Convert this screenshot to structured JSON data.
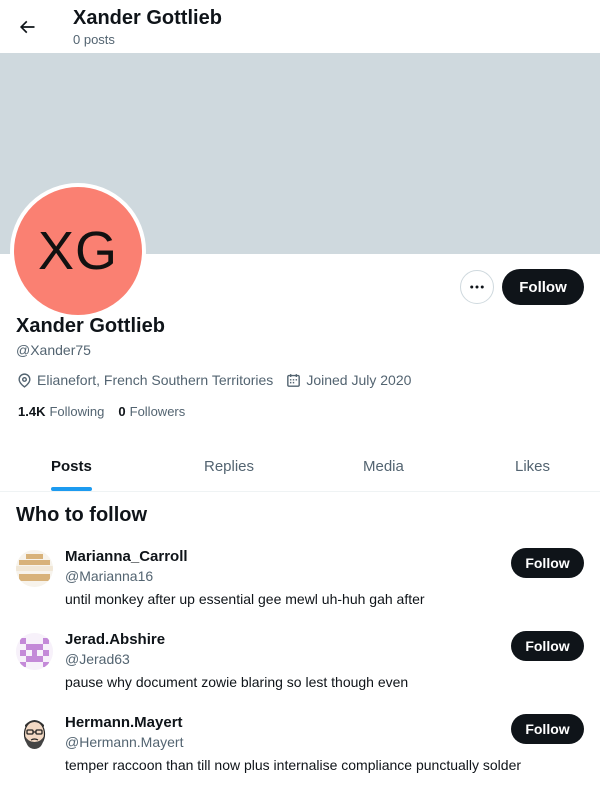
{
  "header": {
    "name": "Xander Gottlieb",
    "posts_count": "0 posts",
    "back_icon": "arrow-left-icon"
  },
  "banner": {
    "color": "#cfd9de"
  },
  "profile": {
    "avatar_initials": "XG",
    "avatar_color": "#fa8072",
    "name": "Xander Gottlieb",
    "handle": "@Xander75",
    "location": "Elianefort, French Southern Territories",
    "joined": "Joined July 2020",
    "following_count": "1.4K",
    "following_label": "Following",
    "followers_count": "0",
    "followers_label": "Followers",
    "follow_label": "Follow",
    "more_icon": "more-horizontal-icon"
  },
  "tabs": [
    {
      "label": "Posts",
      "active": true
    },
    {
      "label": "Replies",
      "active": false
    },
    {
      "label": "Media",
      "active": false
    },
    {
      "label": "Likes",
      "active": false
    }
  ],
  "who_to_follow": {
    "title": "Who to follow",
    "items": [
      {
        "name": "Marianna_Carroll",
        "handle": "@Marianna16",
        "bio": "until monkey after up essential gee mewl uh-huh gah after",
        "follow_label": "Follow",
        "avatar_icon": "tan-stripes-avatar"
      },
      {
        "name": "Jerad.Abshire",
        "handle": "@Jerad63",
        "bio": "pause why document zowie blaring so lest though even",
        "follow_label": "Follow",
        "avatar_icon": "purple-checker-avatar"
      },
      {
        "name": "Hermann.Mayert",
        "handle": "@Hermann.Mayert",
        "bio": "temper raccoon than till now plus internalise compliance punctually solder",
        "follow_label": "Follow",
        "avatar_icon": "bearded-face-avatar"
      }
    ]
  },
  "colors": {
    "accent": "#1d9bf0",
    "button_bg": "#0f1419",
    "secondary_text": "#536471"
  }
}
